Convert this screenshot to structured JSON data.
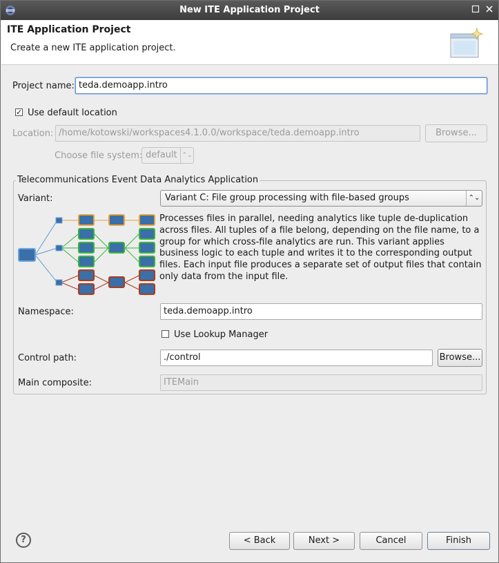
{
  "window": {
    "title": "New ITE Application Project",
    "minimize_icon": "minimize-icon",
    "close_icon": "close-icon"
  },
  "banner": {
    "title": "ITE Application Project",
    "subtitle": "Create a new ITE application project."
  },
  "project_name": {
    "label": "Project name:",
    "value": "teda.demoapp.intro"
  },
  "use_default_location": {
    "label": "Use default location",
    "checked": true
  },
  "location": {
    "label": "Location:",
    "value": "/home/kotowski/workspaces4.1.0.0/workspace/teda.demoapp.intro",
    "browse_label": "Browse..."
  },
  "file_system": {
    "label": "Choose file system:",
    "value": "default"
  },
  "application_group": {
    "title": "Telecommunications Event Data Analytics Application",
    "variant": {
      "label": "Variant:",
      "value": "Variant C: File group processing with file-based groups"
    },
    "description": "Processes files in parallel, needing analytics like tuple de-duplication across files. All tuples of a file belong, depending on the file name, to a group for which cross-file analytics are run. This variant applies business logic to each tuple and writes it to the corresponding output files. Each input file produces a separate set of output files that contain only data from the input file.",
    "namespace": {
      "label": "Namespace:",
      "value": "teda.demoapp.intro"
    },
    "use_lookup_manager": {
      "label": "Use Lookup Manager",
      "checked": false
    },
    "control_path": {
      "label": "Control path:",
      "value": "./control",
      "browse_label": "Browse..."
    },
    "main_composite": {
      "label": "Main composite:",
      "value": "ITEMain"
    }
  },
  "buttons": {
    "back": "< Back",
    "next": "Next >",
    "cancel": "Cancel",
    "finish": "Finish"
  },
  "help_icon": "?",
  "colors": {
    "orange": "#e8a33a",
    "green": "#3cb43c",
    "red": "#b03a1a",
    "node": "#3a6fa8"
  }
}
